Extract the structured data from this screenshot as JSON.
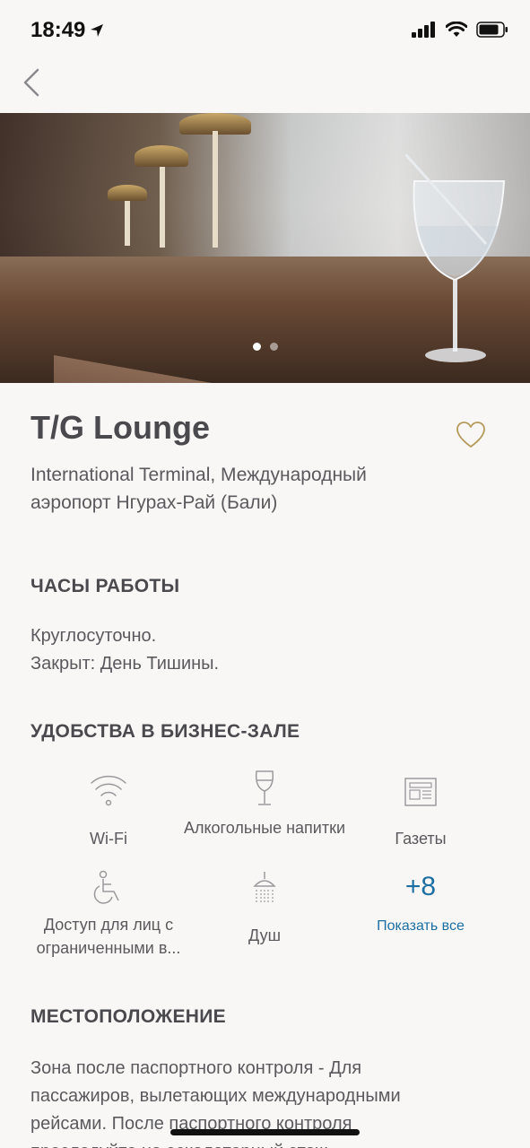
{
  "status_bar": {
    "time": "18:49",
    "icons": [
      "location-arrow-icon",
      "signal-icon",
      "wifi-icon",
      "battery-icon"
    ]
  },
  "nav": {
    "back_icon": "chevron-left-icon"
  },
  "gallery": {
    "page_count": 2,
    "current_page": 1
  },
  "lounge": {
    "name": "T/G Lounge",
    "location": "International Terminal, Международный аэропорт Нгурах-Рай (Бали)",
    "favorite_icon": "heart-outline-icon"
  },
  "hours": {
    "title": "ЧАСЫ РАБОТЫ",
    "line1": "Круглосуточно.",
    "line2": "Закрыт: День Тишины."
  },
  "amenities": {
    "title": "УДОБСТВА В БИЗНЕС-ЗАЛЕ",
    "items": [
      {
        "label": "Wi-Fi",
        "icon": "wifi-icon"
      },
      {
        "label": "Алкогольные напитки",
        "icon": "wine-glass-icon"
      },
      {
        "label": "Газеты",
        "icon": "newspaper-icon"
      },
      {
        "label": "Доступ для лиц с ограниченными в...",
        "icon": "wheelchair-icon"
      },
      {
        "label": "Душ",
        "icon": "shower-icon"
      }
    ],
    "more_count": "+8",
    "more_label": "Показать все"
  },
  "location": {
    "title": "МЕСТОПОЛОЖЕНИЕ",
    "text": "Зона после паспортного контроля - Для пассажиров, вылетающих международными рейсами. После паспортного контроля проследуйте на эскалаторный этаж"
  },
  "colors": {
    "accent": "#1d6fa3",
    "heart": "#b59a5a",
    "background": "#f8f7f5",
    "text": "#4a4a4e"
  }
}
